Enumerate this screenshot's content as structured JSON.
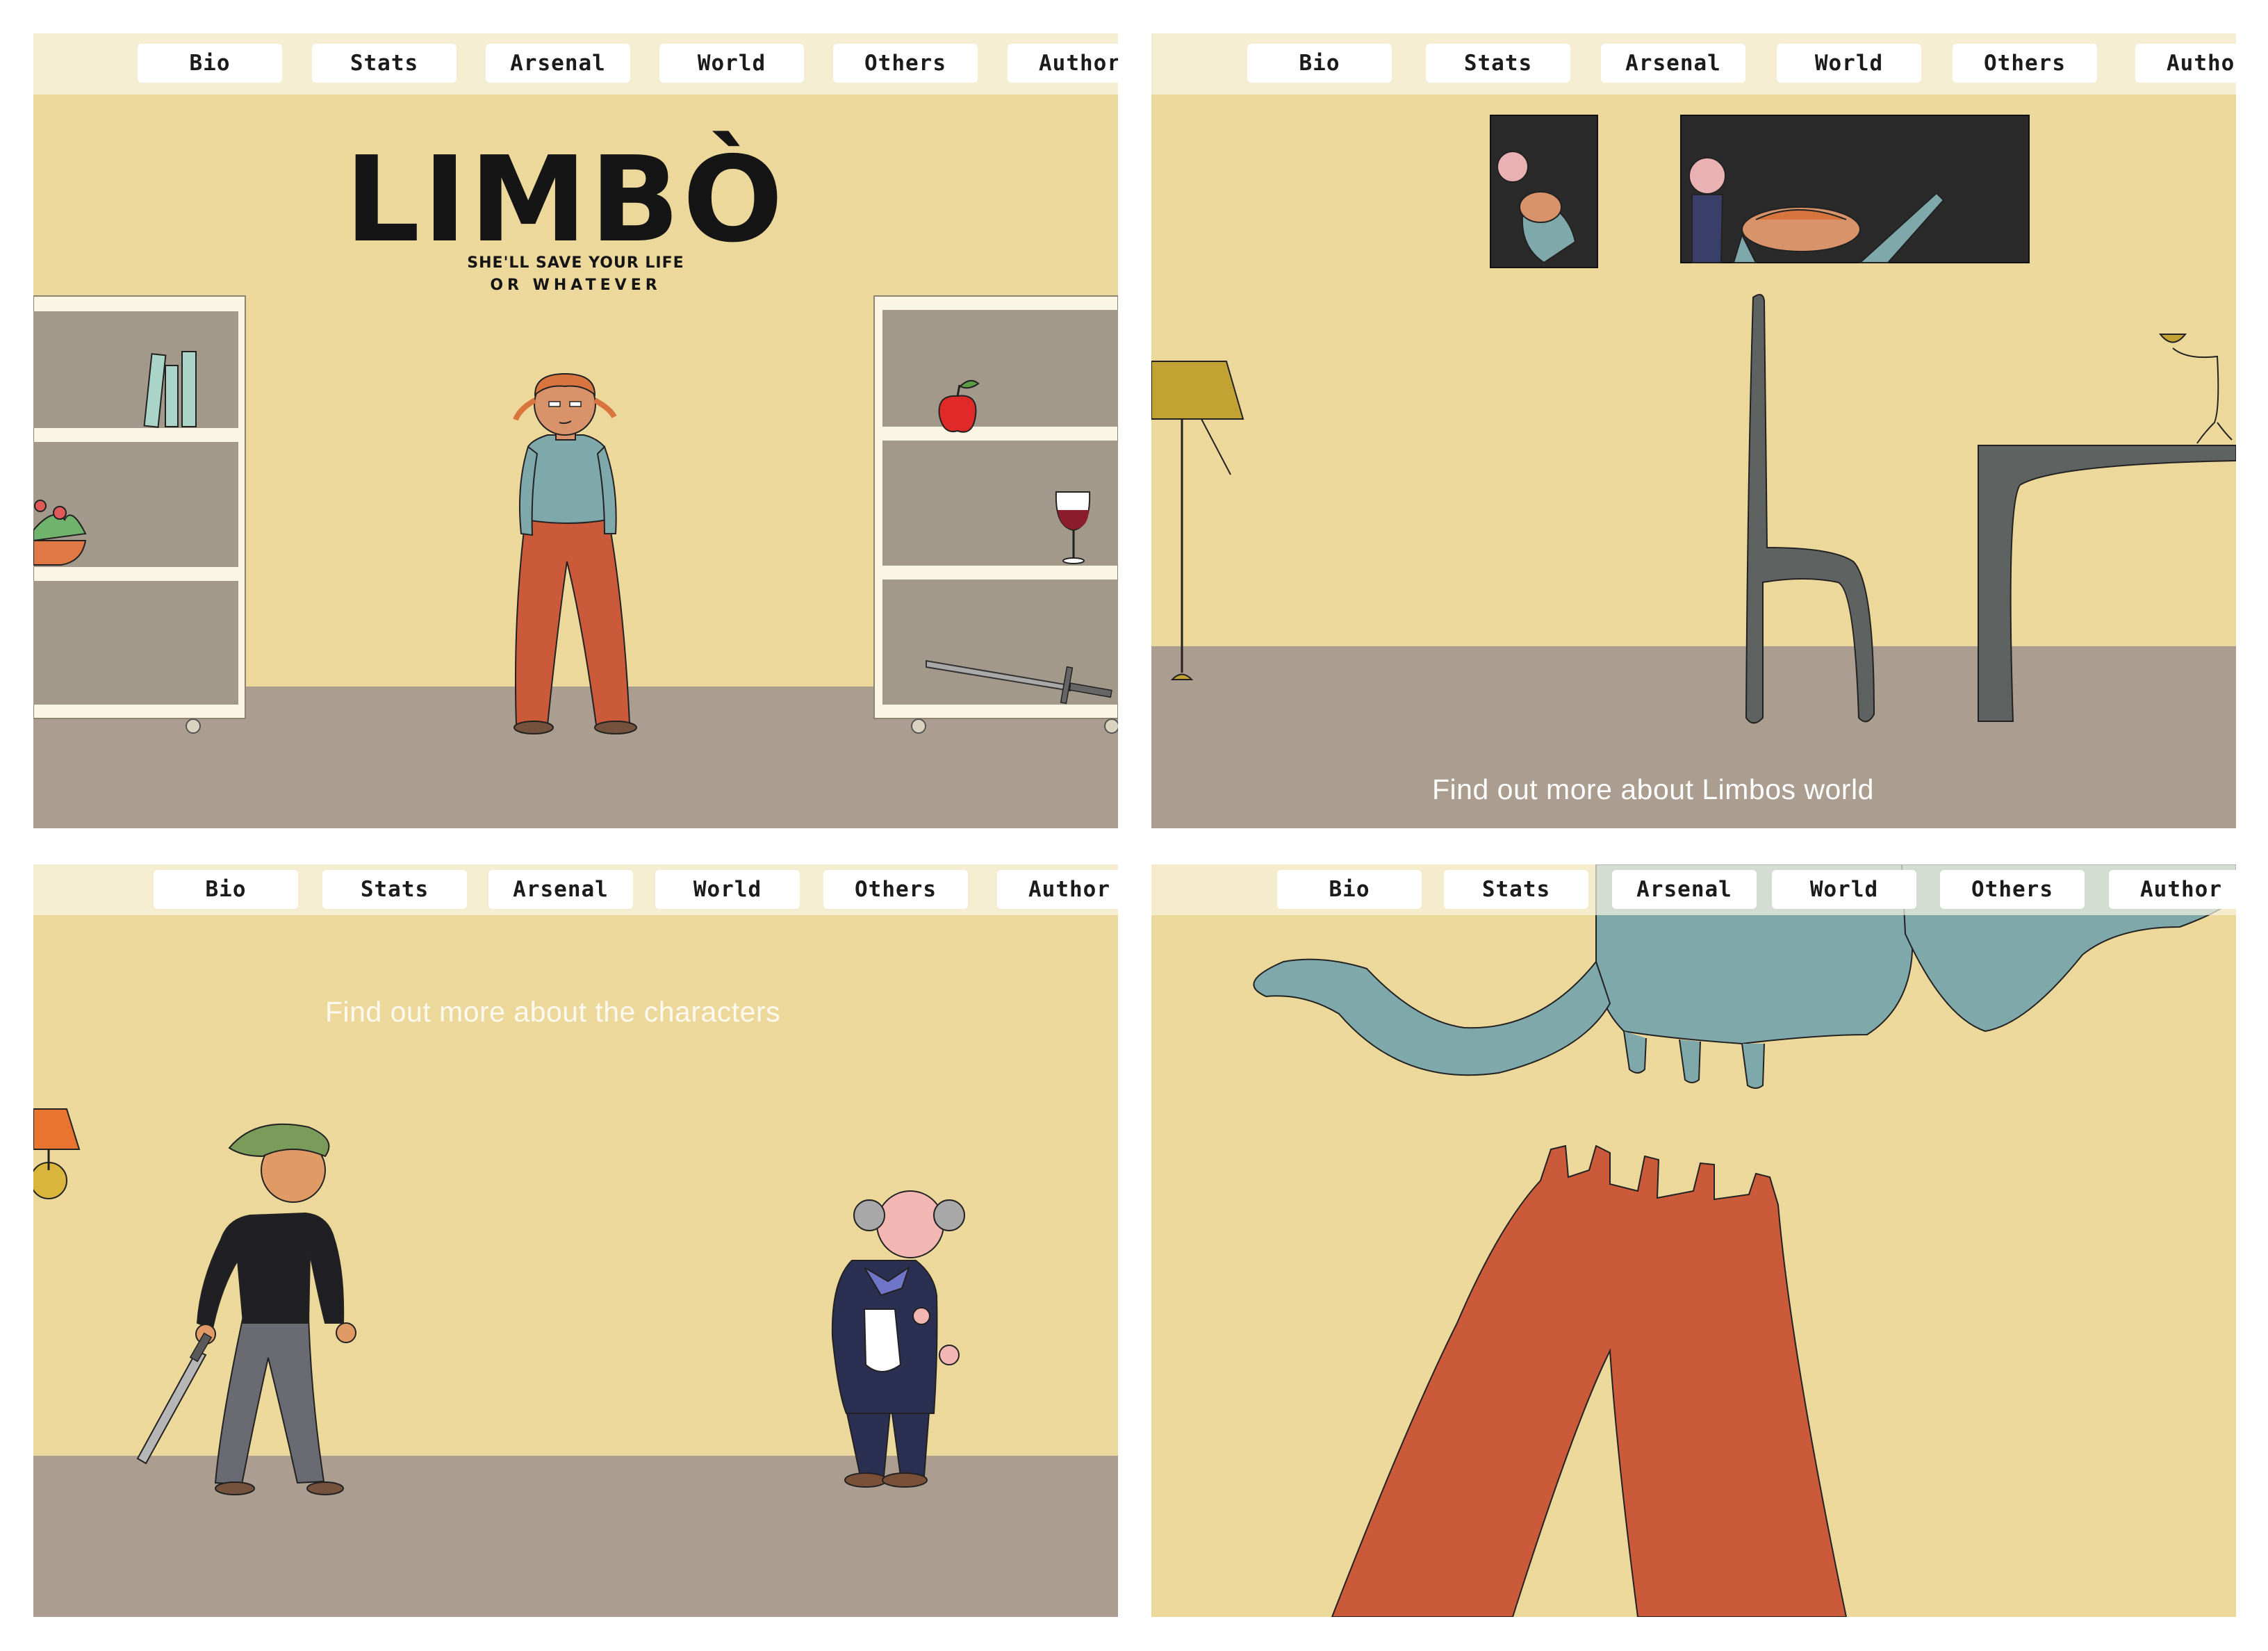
{
  "nav": {
    "items": [
      "Bio",
      "Stats",
      "Arsenal",
      "World",
      "Others",
      "Author"
    ]
  },
  "panel1": {
    "logo_title": "LIMBÒ",
    "logo_tagline_1": "SHE'LL SAVE YOUR LIFE",
    "logo_tagline_2": "OR WHATEVER"
  },
  "panel2": {
    "caption": "Find out more about Limbos world"
  },
  "panel3": {
    "caption": "Find out more about the characters"
  },
  "colors": {
    "wall": "#edd89b",
    "floor": "#ab9d8f",
    "navbar": "#f8f3e2",
    "shirt": "#7fa8aa",
    "pants": "#cb5a3a"
  }
}
